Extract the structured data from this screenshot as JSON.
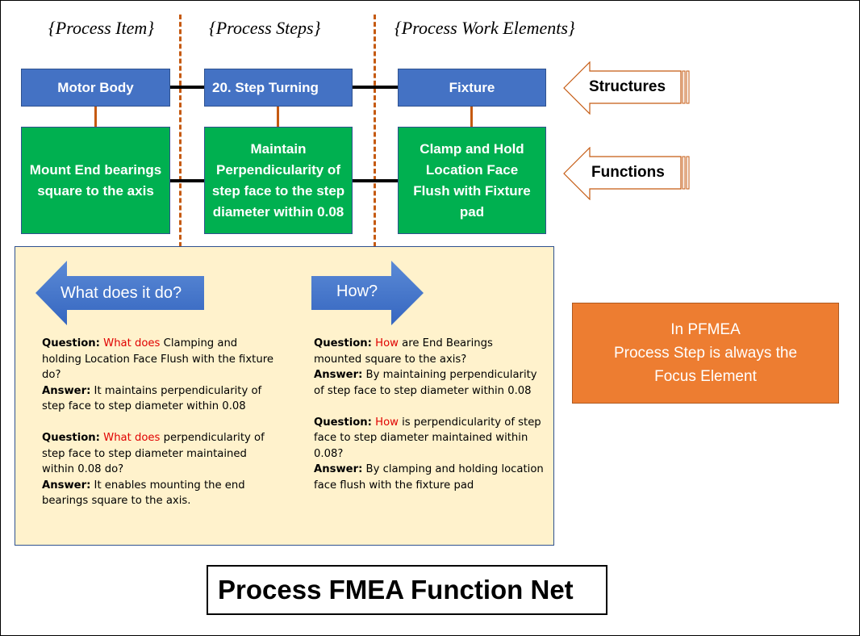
{
  "diagram": {
    "title": "Process FMEA Function Net",
    "column_headers": [
      "{Process Item}",
      "{Process Steps}",
      "{Process Work Elements}"
    ],
    "structures": [
      "Motor Body",
      "20. Step Turning",
      "Fixture"
    ],
    "functions": [
      "Mount End bearings square to the axis",
      "Maintain Perpendicularity of step face to the step diameter within 0.08",
      "Clamp and Hold Location Face Flush with Fixture pad"
    ],
    "side_labels": {
      "structures": "Structures",
      "functions": "Functions"
    },
    "direction_arrows": {
      "left": "What does it do?",
      "right": "How?"
    },
    "what_qa": [
      {
        "q_label": "Question:",
        "q_highlight": "What does",
        "q_text": " Clamping and holding Location Face Flush with the fixture do?",
        "a_label": "Answer:",
        "a_text": " It maintains perpendicularity of step face to step diameter within 0.08"
      },
      {
        "q_label": "Question:",
        "q_highlight": "What does",
        "q_text": " perpendicularity of step face to step diameter maintained within 0.08 do?",
        "a_label": "Answer:",
        "a_text": " It enables mounting the end bearings square to the axis."
      }
    ],
    "how_qa": [
      {
        "q_label": "Question:",
        "q_highlight": "How",
        "q_text": " are End Bearings mounted square to the axis?",
        "a_label": "Answer:",
        "a_text": " By maintaining perpendicularity of step face to step diameter within 0.08"
      },
      {
        "q_label": "Question:",
        "q_highlight": "How",
        "q_text": " is perpendicularity of step face to step diameter maintained within 0.08?",
        "a_label": "Answer:",
        "a_text": " By clamping and holding location face flush with the fixture pad"
      }
    ],
    "note_lines": [
      "In PFMEA",
      "Process Step is always the",
      "Focus Element"
    ],
    "colors": {
      "structure_fill": "#4472c4",
      "function_fill": "#00b050",
      "divider": "#c55a11",
      "qa_panel": "#fff2cc",
      "highlight": "#e00000",
      "note_fill": "#ed7d31"
    }
  }
}
